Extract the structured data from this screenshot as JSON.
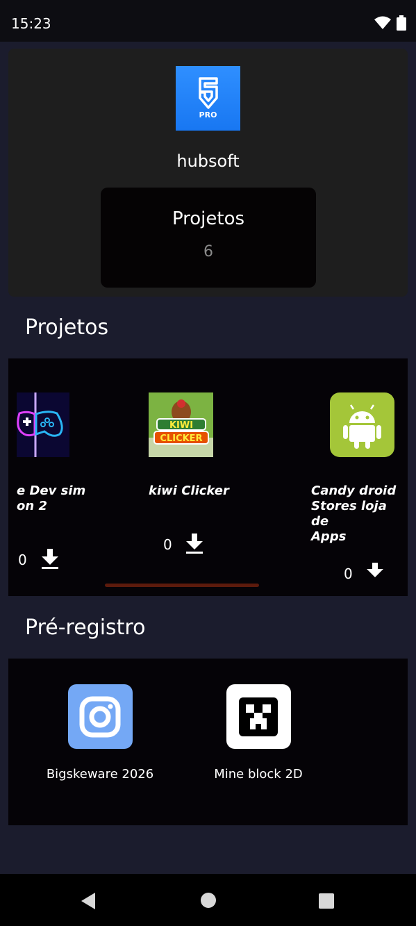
{
  "status": {
    "time": "15:23"
  },
  "profile": {
    "logo_badge": "PRO",
    "username": "hubsoft",
    "stat_label": "Projetos",
    "stat_value": "6"
  },
  "sections": {
    "projects_title": "Projetos",
    "prereg_title": "Pré-registro"
  },
  "projects": [
    {
      "name_line1": "e Dev sim",
      "name_line2": "on 2",
      "downloads": "0",
      "icon": "gamepad-icon"
    },
    {
      "name": "kiwi Clicker",
      "downloads": "0",
      "icon": "kiwi-clicker-icon"
    },
    {
      "name_line1": "Candy droid",
      "name_line2": "Stores loja de",
      "name_line3": "Apps",
      "downloads": "0",
      "icon": "android-icon"
    }
  ],
  "preregistro": [
    {
      "name": "Bigskeware 2026",
      "icon": "instagram-icon",
      "color": "#74a8f5"
    },
    {
      "name": "Mine block 2D",
      "icon": "creeper-icon",
      "color": "#ffffff"
    }
  ],
  "colors": {
    "background": "#1b1c2d",
    "card": "#1e1e1e",
    "panel": "#050307",
    "logo_blue": "#1877f2",
    "android_green": "#a4c639",
    "scroll_indicator": "#5c1a0c"
  }
}
